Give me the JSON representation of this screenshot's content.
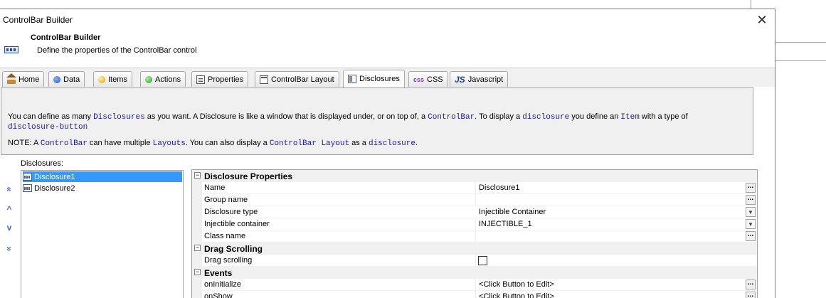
{
  "window": {
    "title": "ControlBar Builder",
    "close_glyph": "✕"
  },
  "header": {
    "title": "ControlBar Builder",
    "description": "Define the properties of the ControlBar control",
    "icon": "controlbar-icon"
  },
  "tabs": [
    {
      "label": "Home",
      "icon": "home-icon"
    },
    {
      "label": "Data",
      "icon": "data-icon"
    },
    {
      "label": "Items",
      "icon": "items-icon"
    },
    {
      "label": "Actions",
      "icon": "actions-icon"
    },
    {
      "label": "Properties",
      "icon": "properties-icon"
    },
    {
      "label": "ControlBar Layout",
      "icon": "layout-icon"
    },
    {
      "label": "Disclosures",
      "icon": "disclosures-icon",
      "active": true
    },
    {
      "label": "CSS",
      "icon_text": "css",
      "icon": "css-icon"
    },
    {
      "label": "Javascript",
      "icon_text": "JS",
      "icon": "js-icon"
    }
  ],
  "info": {
    "line1": {
      "t1": "You can define as many ",
      "c1": "Disclosures",
      "t2": " as you want. A Disclosure is like a window that is displayed under, or on top of, a ",
      "c2": "ControlBar",
      "t3": ". To display a ",
      "c3": "disclosure",
      "t4": " you define an ",
      "c4": "Item",
      "t5": " with a type of"
    },
    "line2": {
      "c1": "disclosure-button"
    },
    "line3": {
      "t1": "NOTE: A ",
      "c1": "ControlBar",
      "t2": " can have multiple ",
      "c2": "Layouts",
      "t3": ". You can also display a ",
      "c3": "ControlBar Layout",
      "t4": " as a ",
      "c4": "disclosure",
      "t5": "."
    }
  },
  "disclosures": {
    "label": "Disclosures:",
    "items": [
      {
        "label": "Disclosure1",
        "selected": true
      },
      {
        "label": "Disclosure2",
        "selected": false
      }
    ],
    "nav": {
      "top": "«",
      "up": "^",
      "down": "v",
      "bottom": "»"
    }
  },
  "grid": {
    "categories": {
      "properties": "Disclosure Properties",
      "scrolling": "Drag Scrolling",
      "events": "Events"
    },
    "toggle_glyph": "−",
    "rows": {
      "name": {
        "label": "Name",
        "value": "Disclosure1"
      },
      "group": {
        "label": "Group name",
        "value": ""
      },
      "type": {
        "label": "Disclosure type",
        "value": "Injectible Container"
      },
      "container": {
        "label": "Injectible container",
        "value": "INJECTIBLE_1"
      },
      "class": {
        "label": "Class name",
        "value": ""
      },
      "drag": {
        "label": "Drag scrolling",
        "checked": false
      },
      "oninit": {
        "label": "onInitialize",
        "value": "<Click Button to Edit>"
      },
      "onshow": {
        "label": "onShow",
        "value": "<Click Button to Edit>"
      }
    },
    "dots_glyph": "...",
    "drop_glyph": "▼"
  },
  "colors": {
    "highlight": "#ffff1a",
    "selection": "#3399ff",
    "code": "#1a1aa6"
  }
}
